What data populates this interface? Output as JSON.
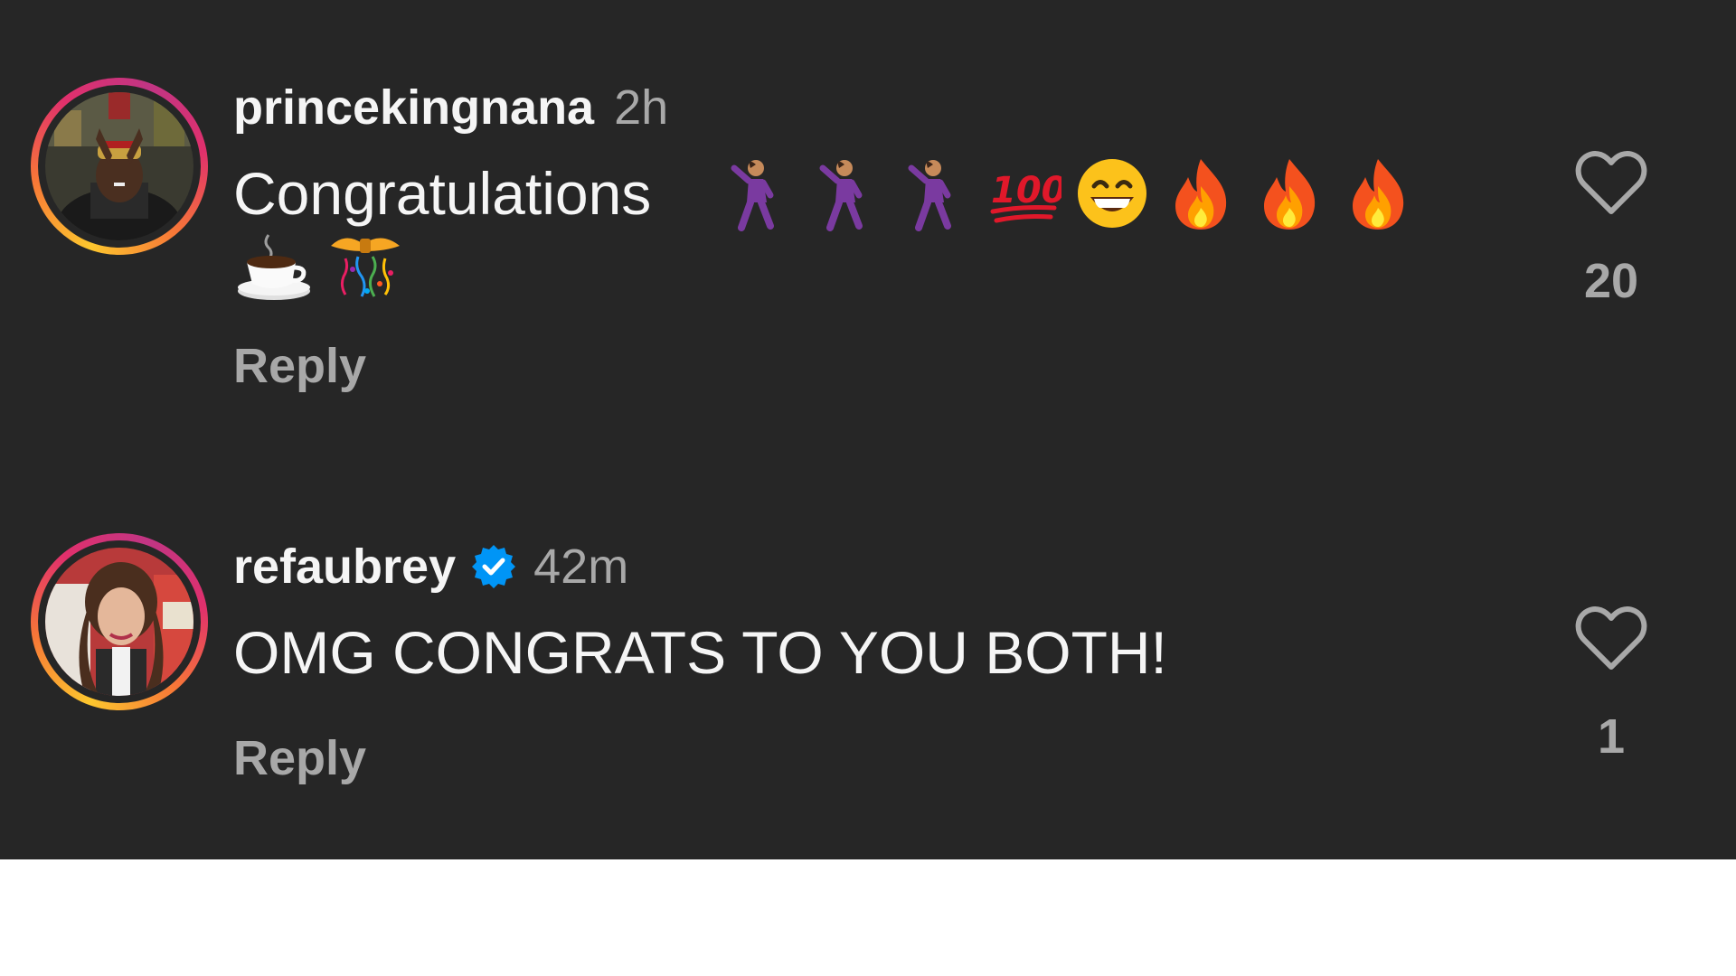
{
  "comments": [
    {
      "username": "princekingnana",
      "time": "2h",
      "text": "Congratulations",
      "emojis": [
        "man-dancing-emoji",
        "man-dancing-emoji",
        "man-dancing-emoji",
        "hundred-points-emoji",
        "grinning-face-emoji",
        "fire-emoji",
        "fire-emoji",
        "fire-emoji",
        "hot-beverage-emoji",
        "confetti-ball-emoji"
      ],
      "reply_label": "Reply",
      "likes": "20",
      "verified": false
    },
    {
      "username": "refaubrey",
      "time": "42m",
      "text": "OMG CONGRATS TO YOU BOTH!",
      "reply_label": "Reply",
      "likes": "1",
      "verified": true
    }
  ],
  "colors": {
    "background": "#262626",
    "primary_text": "#f5f5f5",
    "secondary_text": "#a8a8a8",
    "verified_blue": "#0095f6"
  }
}
